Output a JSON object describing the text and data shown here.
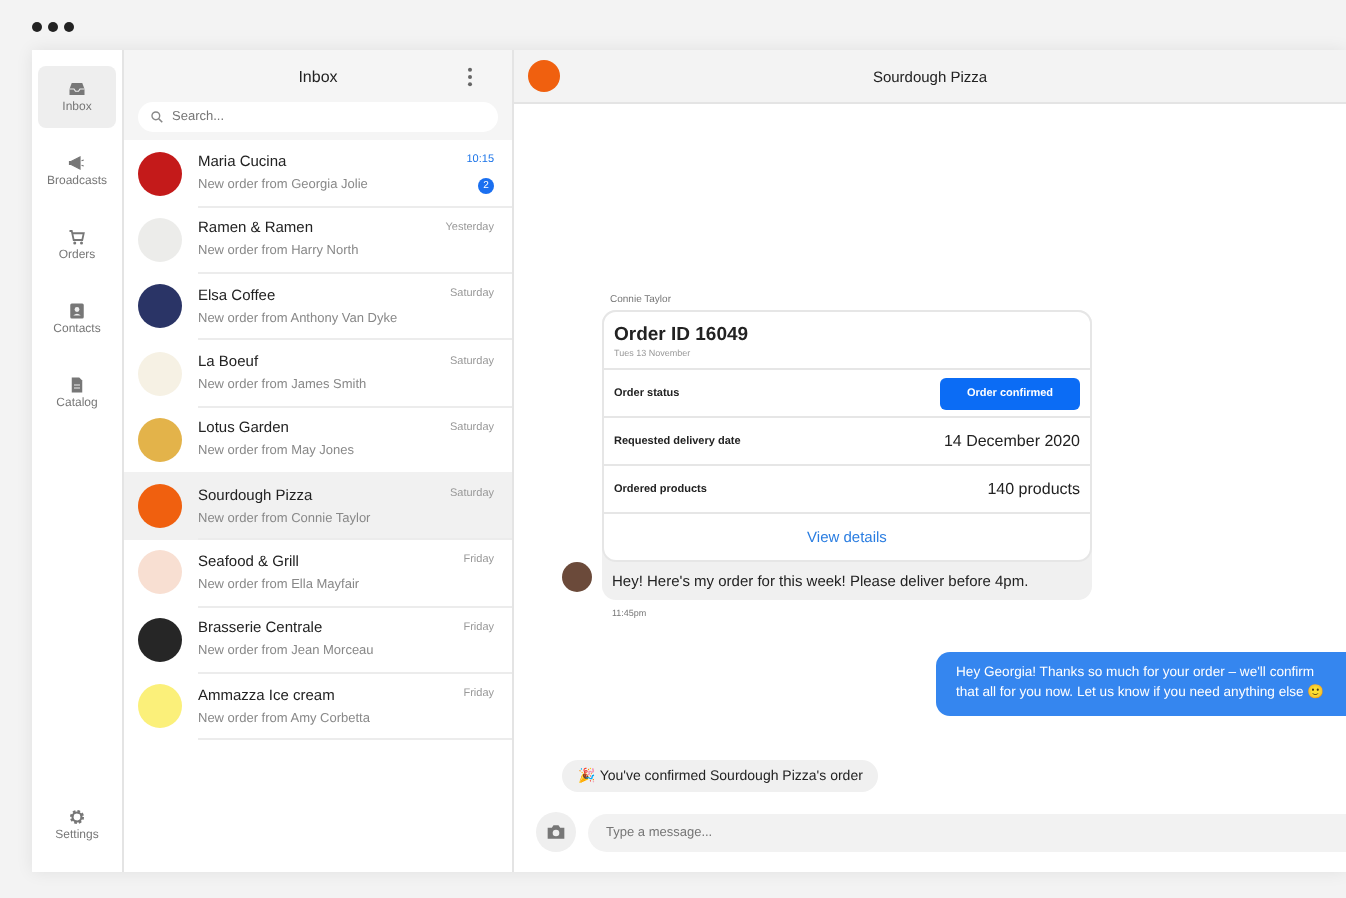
{
  "sidebar": {
    "items": [
      {
        "label": "Inbox",
        "kind": "inbox",
        "selected": true
      },
      {
        "label": "Broadcasts",
        "kind": "broadcasts",
        "selected": false
      },
      {
        "label": "Orders",
        "kind": "orders",
        "selected": false
      },
      {
        "label": "Contacts",
        "kind": "contacts",
        "selected": false
      },
      {
        "label": "Catalog",
        "kind": "catalog",
        "selected": false
      }
    ],
    "footer": {
      "label": "Settings",
      "selected": false
    }
  },
  "inbox": {
    "title": "Inbox",
    "search": {
      "placeholder": "Search..."
    },
    "chats": [
      {
        "name": "Maria Cucina",
        "preview": "New order from Georgia Jolie",
        "time": "10:15",
        "badge": "2",
        "selected": false,
        "color": "#c41a1a"
      },
      {
        "name": "Ramen & Ramen",
        "preview": "New order from Harry North",
        "time": "Yesterday",
        "selected": false,
        "color": "#ececea"
      },
      {
        "name": "Elsa Coffee",
        "preview": "New order from Anthony Van Dyke",
        "time": "Saturday",
        "selected": false,
        "color": "#2a3466"
      },
      {
        "name": "La Boeuf",
        "preview": "New order from James Smith",
        "time": "Saturday",
        "selected": false,
        "color": "#f6f1e4"
      },
      {
        "name": "Lotus Garden",
        "preview": "New order from May Jones",
        "time": "Saturday",
        "selected": false,
        "color": "#e3b34a"
      },
      {
        "name": "Sourdough Pizza",
        "preview": "New order from Connie Taylor",
        "time": "Saturday",
        "selected": true,
        "color": "#f0600f"
      },
      {
        "name": "Seafood & Grill",
        "preview": "New order from Ella Mayfair",
        "time": "Friday",
        "selected": false,
        "color": "#f8dfd2"
      },
      {
        "name": "Brasserie Centrale",
        "preview": "New order from Jean Morceau",
        "time": "Friday",
        "selected": false,
        "color": "#262626"
      },
      {
        "name": "Ammazza Ice cream",
        "preview": "New order from Amy Corbetta",
        "time": "Friday",
        "selected": false,
        "color": "#fbf07a"
      }
    ]
  },
  "conversation": {
    "title": "Sourdough Pizza",
    "order": {
      "sender": "Connie Taylor",
      "title": "Order ID 16049",
      "date": "Tues 13 November",
      "rows": [
        {
          "label": "Order status",
          "kind": "button",
          "value": "Order confirmed"
        },
        {
          "label": "Requested delivery date",
          "kind": "text",
          "value": "14 December 2020"
        },
        {
          "label": "Ordered products",
          "kind": "text",
          "value": "140 products"
        }
      ],
      "link": "View details"
    },
    "incoming": {
      "text": "Hey! Here's my order for this week! Please deliver before 4pm.",
      "time": "11:45pm"
    },
    "outgoing": {
      "text": "Hey Georgia! Thanks so much for your order – we'll confirm that all for you now. Let us know if you need anything else 🙂"
    },
    "event": {
      "text": "🎉 You've confirmed Sourdough Pizza's order"
    },
    "composer": {
      "placeholder": "Type a message..."
    }
  }
}
